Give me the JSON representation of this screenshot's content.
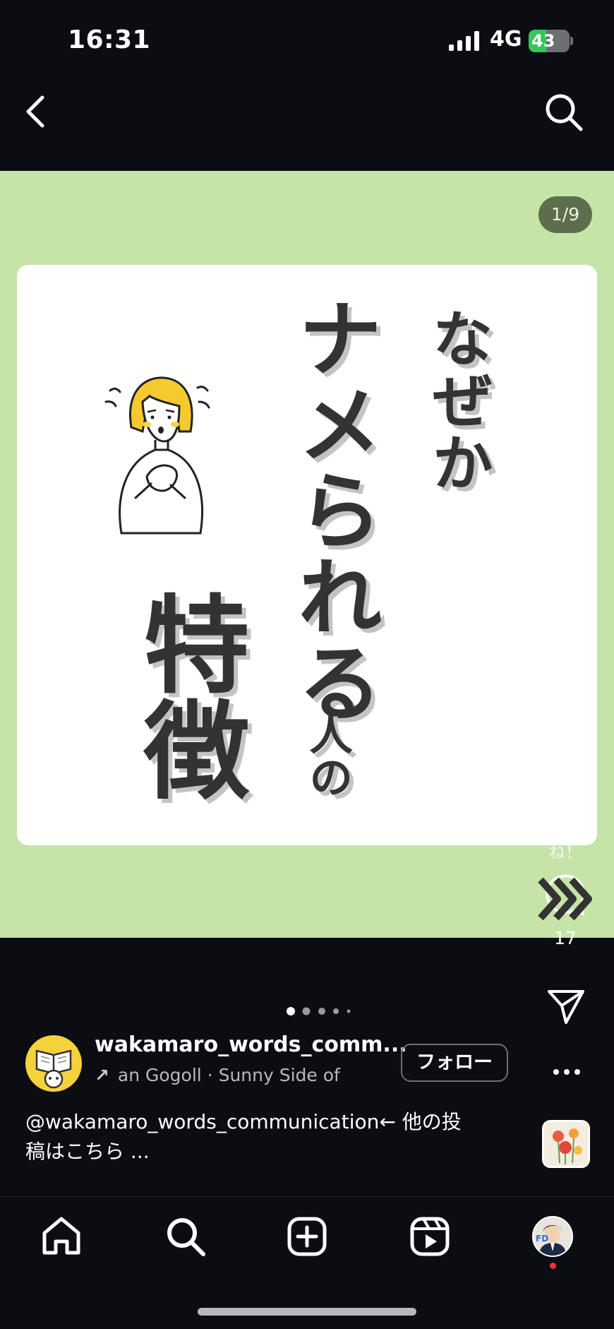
{
  "status_bar": {
    "time": "16:31",
    "network": "4G",
    "battery": "43",
    "battery_level": 0.43,
    "charging": true
  },
  "header": {
    "back_icon": "chevron-left-icon",
    "search_icon": "search-icon"
  },
  "post": {
    "counter": "1/9",
    "background_color": "#c6e3a8",
    "title_lines": [
      "なぜか",
      "ナメられる",
      "人の",
      "特徴"
    ],
    "illustration": "worried-woman-illustration"
  },
  "actions": {
    "like_label": "いいね！",
    "comment_count": "17",
    "share_icon": "send-icon",
    "more_icon": "more-icon"
  },
  "carousel": {
    "current": 1,
    "dots": 5
  },
  "account": {
    "username": "wakamaro_words_comm...",
    "music": "an Gogoll · Sunny Side of",
    "follow_label": "フォロー"
  },
  "caption": {
    "text_line1": "@wakamaro_words_communication← 他の投",
    "text_line2": "稿はこちら ..."
  },
  "bottom_nav": {
    "items": [
      "home-icon",
      "search-icon",
      "create-icon",
      "reels-icon",
      "profile-avatar"
    ]
  },
  "colors": {
    "background": "#0b0d12",
    "accent_green": "#c6e3a8",
    "battery_green": "#34c759",
    "notification": "#ff2d44"
  }
}
